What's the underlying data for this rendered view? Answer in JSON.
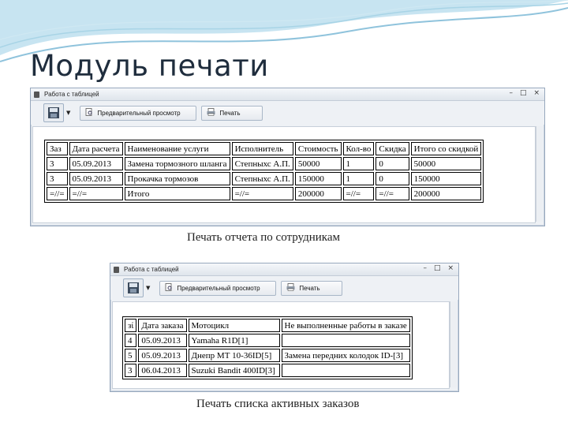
{
  "slide": {
    "title": "Модуль печати"
  },
  "window1": {
    "title": "Работа с таблицей",
    "controls": [
      "–",
      "□",
      "×"
    ],
    "toolbar": {
      "preview_label": "Предварительный просмотр",
      "print_label": "Печать"
    },
    "table": {
      "columns": [
        "Заз",
        "Дата расчета",
        "Наименование услуги",
        "Исполнитель",
        "Стоимость",
        "Кол-во",
        "Скидка",
        "Итого со скидкой"
      ],
      "rows": [
        [
          "3",
          "05.09.2013",
          "Замена тормозного шланга",
          "Степныхс А.П.",
          "50000",
          "1",
          "0",
          "50000"
        ],
        [
          "3",
          "05.09.2013",
          "Прокачка тормозов",
          "Степныхс А.П.",
          "150000",
          "1",
          "0",
          "150000"
        ],
        [
          "=//=",
          "=//=",
          "Итого",
          "=//=",
          "200000",
          "=//=",
          "=//=",
          "200000"
        ]
      ]
    },
    "caption": "Печать отчета по сотрудникам"
  },
  "window2": {
    "title": "Работа с таблицей",
    "controls": [
      "–",
      "□",
      "×"
    ],
    "toolbar": {
      "preview_label": "Предварительный просмотр",
      "print_label": "Печать"
    },
    "table": {
      "columns": [
        "зί",
        "Дата заказа",
        "Мотоцикл",
        "Не выполненные работы в заказе"
      ],
      "rows": [
        [
          "4",
          "05.09.2013",
          "Yamaha R1D[1]",
          ""
        ],
        [
          "5",
          "05.09.2013",
          "Днепр МТ 10-36ID[5]",
          "Замена передних колодок ID-[3]"
        ],
        [
          "3",
          "06.04.2013",
          "Suzuki Bandit 400ID[3]",
          ""
        ]
      ]
    },
    "caption": "Печать списка активных заказов"
  },
  "colors": {
    "title": "#1f2d3d",
    "wave": "#8fc3dc",
    "window_border": "#97a8bd"
  },
  "icons": [
    "save-icon",
    "preview-icon",
    "print-icon",
    "app-icon"
  ]
}
